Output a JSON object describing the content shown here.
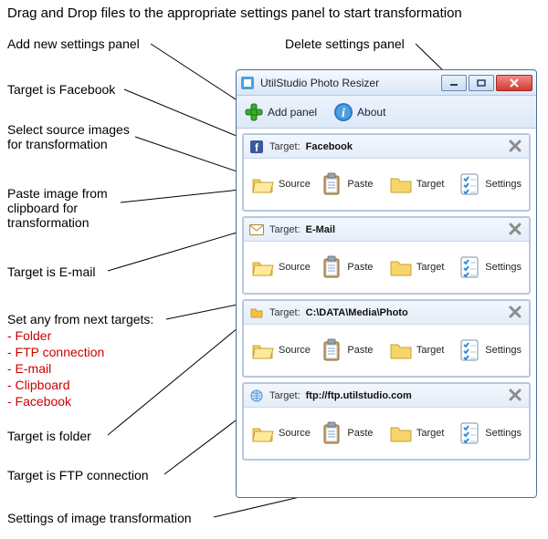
{
  "annotations": {
    "top": "Drag and Drop files to the appropriate settings panel to start transformation",
    "add_panel": "Add new settings panel",
    "delete_panel": "Delete settings panel",
    "target_fb": "Target is Facebook",
    "select_src_1": "Select source images",
    "select_src_2": "for transformation",
    "paste_1": "Paste image from",
    "paste_2": "clipboard for",
    "paste_3": "transformation",
    "target_email": "Target is E-mail",
    "set_targets_head": "Set any from next targets:",
    "set_targets_1": "- Folder",
    "set_targets_2": "- FTP connection",
    "set_targets_3": "- E-mail",
    "set_targets_4": "- Clipboard",
    "set_targets_5": "- Facebook",
    "target_folder": "Target is folder",
    "target_ftp": "Target is FTP connection",
    "settings_label": "Settings of image transformation"
  },
  "window": {
    "title": "UtilStudio Photo Resizer",
    "toolbar": {
      "add_panel": "Add panel",
      "about": "About"
    },
    "panels": [
      {
        "target_label": "Target:",
        "target_value": "Facebook",
        "actions": {
          "source": "Source",
          "paste": "Paste",
          "target": "Target",
          "settings": "Settings"
        }
      },
      {
        "target_label": "Target:",
        "target_value": "E-Mail",
        "actions": {
          "source": "Source",
          "paste": "Paste",
          "target": "Target",
          "settings": "Settings"
        }
      },
      {
        "target_label": "Target:",
        "target_value": "C:\\DATA\\Media\\Photo",
        "actions": {
          "source": "Source",
          "paste": "Paste",
          "target": "Target",
          "settings": "Settings"
        }
      },
      {
        "target_label": "Target:",
        "target_value": "ftp://ftp.utilstudio.com",
        "actions": {
          "source": "Source",
          "paste": "Paste",
          "target": "Target",
          "settings": "Settings"
        }
      }
    ]
  }
}
